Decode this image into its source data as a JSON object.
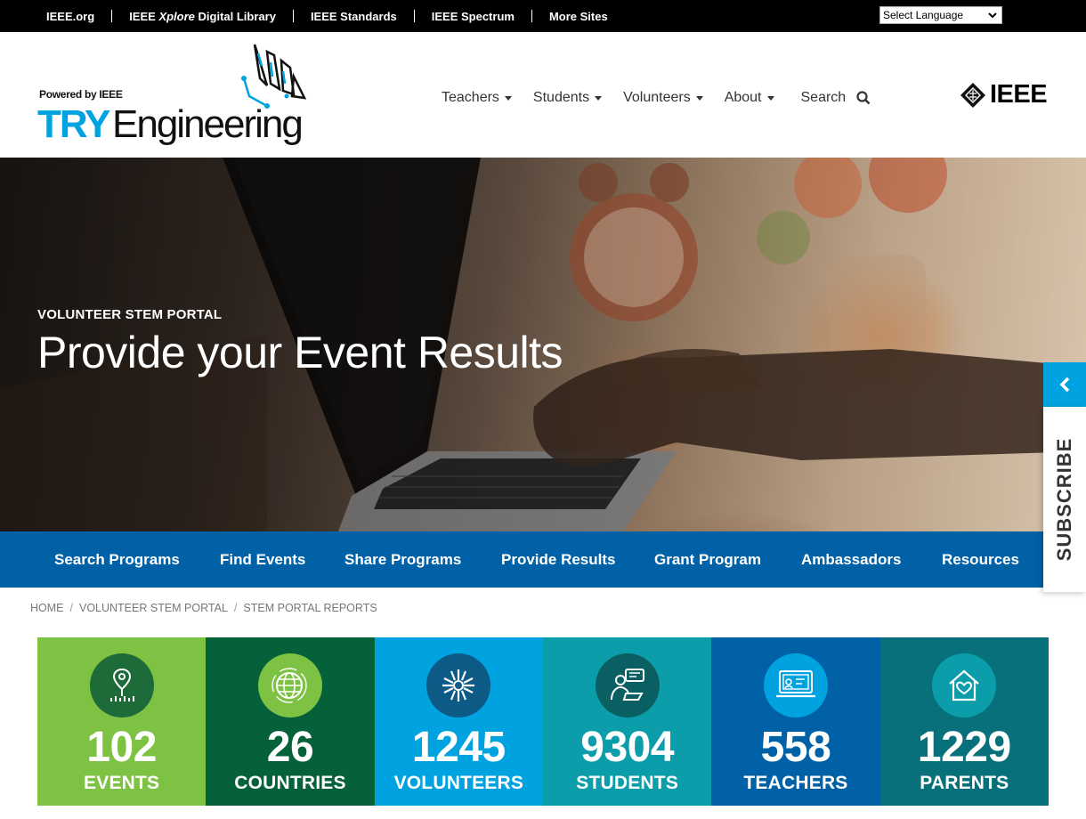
{
  "top_bar": {
    "links": [
      {
        "label": "IEEE.org"
      },
      {
        "label_prefix": "IEEE ",
        "label_italic": "Xplore",
        "label_suffix": " Digital Library"
      },
      {
        "label": "IEEE Standards"
      },
      {
        "label": "IEEE Spectrum"
      },
      {
        "label": "More Sites"
      }
    ],
    "language_select": {
      "value": "Select Language",
      "icon": "chevron-down-icon"
    }
  },
  "header": {
    "logo": {
      "powered_by": "Powered by IEEE",
      "try": "TRY",
      "engineering": "Engineering"
    },
    "nav": [
      {
        "label": "Teachers"
      },
      {
        "label": "Students"
      },
      {
        "label": "Volunteers"
      },
      {
        "label": "About"
      }
    ],
    "search_label": "Search",
    "ieee_logo_text": "IEEE"
  },
  "hero": {
    "kicker": "VOLUNTEER STEM PORTAL",
    "title": "Provide your Event Results"
  },
  "subscribe": {
    "label": "SUBSCRIBE",
    "arrow_icon": "chevron-left-icon"
  },
  "subnav": [
    {
      "label": "Search Programs"
    },
    {
      "label": "Find Events"
    },
    {
      "label": "Share Programs"
    },
    {
      "label": "Provide Results"
    },
    {
      "label": "Grant Program"
    },
    {
      "label": "Ambassadors"
    },
    {
      "label": "Resources"
    }
  ],
  "breadcrumb": [
    "HOME",
    "VOLUNTEER STEM PORTAL",
    "STEM PORTAL REPORTS"
  ],
  "stats": [
    {
      "value": "102",
      "label": "EVENTS",
      "icon": "map-pin-icon",
      "bg": "#7dc242",
      "circle": "#1e6b3a"
    },
    {
      "value": "26",
      "label": "COUNTRIES",
      "icon": "globe-icon",
      "bg": "#05613a",
      "circle": "#7dc242"
    },
    {
      "value": "1245",
      "label": "VOLUNTEERS",
      "icon": "hands-icon",
      "bg": "#00a3e0",
      "circle": "#0d5a86"
    },
    {
      "value": "9304",
      "label": "STUDENTS",
      "icon": "student-laptop-icon",
      "bg": "#0b9eaa",
      "circle": "#0a5f63"
    },
    {
      "value": "558",
      "label": "TEACHERS",
      "icon": "presentation-board-icon",
      "bg": "#0061a6",
      "circle": "#00a3e0"
    },
    {
      "value": "1229",
      "label": "PARENTS",
      "icon": "house-heart-icon",
      "bg": "#08707a",
      "circle": "#0b9eaa"
    }
  ]
}
